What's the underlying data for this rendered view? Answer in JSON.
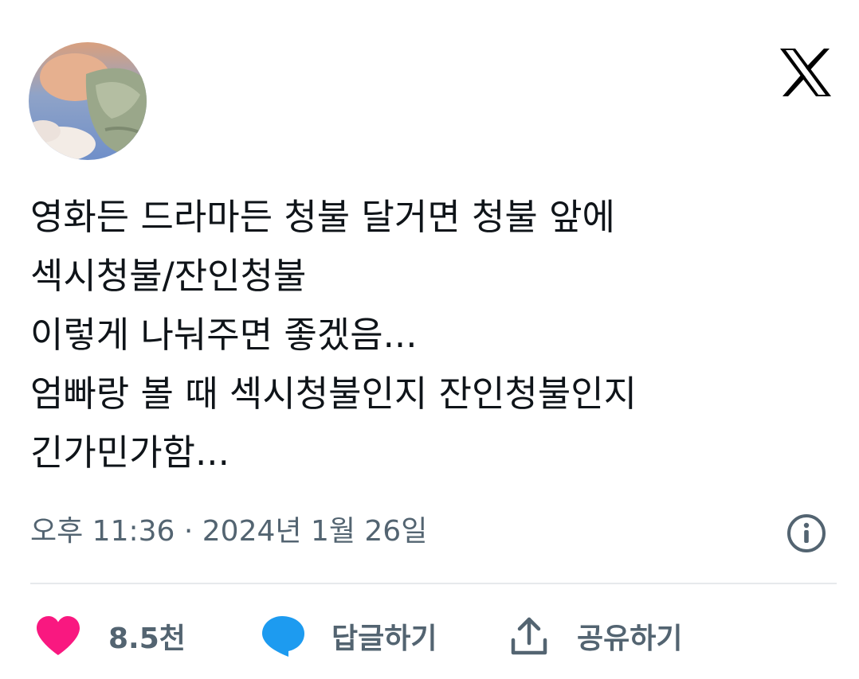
{
  "tweet": {
    "text_lines": [
      "영화든 드라마든 청불 달거면 청불 앞에",
      "섹시청불/잔인청불",
      "이렇게 나눠주면 좋겠음...",
      "엄빠랑 볼 때 섹시청불인지 잔인청불인지",
      "긴가민가함..."
    ],
    "timestamp": "오후 11:36 · 2024년 1월 26일"
  },
  "actions": {
    "like_count": "8.5천",
    "reply_label": "답글하기",
    "share_label": "공유하기"
  },
  "icons": {
    "brand": "x-logo-icon",
    "info": "info-icon",
    "like": "heart-icon",
    "reply": "speech-bubble-icon",
    "share": "share-upload-icon"
  },
  "colors": {
    "like": "#f91880",
    "reply": "#1d9bf0",
    "secondary_text": "#536471",
    "text": "#0f1419"
  }
}
